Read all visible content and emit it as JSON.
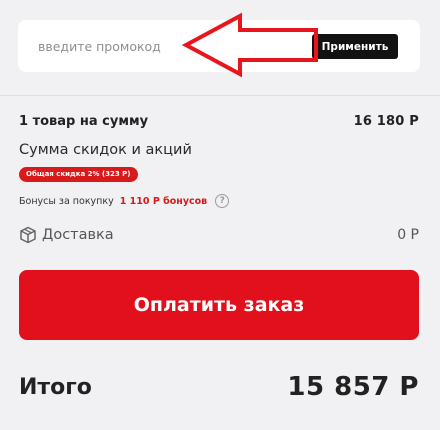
{
  "promo": {
    "placeholder": "введите промокод",
    "apply_label": "Применить"
  },
  "summary": {
    "items_label": "1 товар на сумму",
    "items_value": "16 180 Р",
    "discounts_label": "Сумма скидок и акций",
    "discount_badge": "Общая скидка 2% (323 Р)",
    "bonus_label": "Бонусы за покупку",
    "bonus_value": "1 110 Р бонусов",
    "help_glyph": "?",
    "delivery_label": "Доставка",
    "delivery_value": "0 Р"
  },
  "pay_button_label": "Оплатить заказ",
  "total": {
    "label": "Итого",
    "value": "15 857 Р"
  },
  "colors": {
    "accent_red": "#e2101d",
    "badge_red": "#d81a1a",
    "annotation_arrow": "#e8151c",
    "button_dark": "#121212",
    "page_background": "#f1f1f3"
  }
}
